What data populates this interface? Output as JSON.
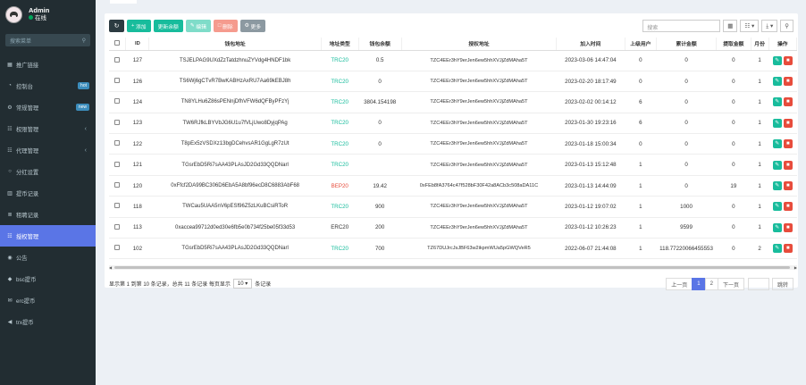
{
  "user": {
    "name": "Admin",
    "status": "在线"
  },
  "sidebar": {
    "search_placeholder": "搜索菜单",
    "items": [
      {
        "label": "推广链接",
        "icon": "table-icon"
      },
      {
        "label": "控制台",
        "icon": "dashboard-icon",
        "badge": "hot",
        "badge_color": "#3c8dbc"
      },
      {
        "label": "常规管理",
        "icon": "cogs-icon",
        "badge": "new",
        "badge_color": "#3c8dbc"
      },
      {
        "label": "权限管理",
        "icon": "group-icon",
        "arrow": true
      },
      {
        "label": "代理管理",
        "icon": "users-icon",
        "arrow": true
      },
      {
        "label": "分红设置",
        "icon": "circle-icon"
      },
      {
        "label": "提币记录",
        "icon": "chart-icon"
      },
      {
        "label": "租聘记录",
        "icon": "list-icon"
      },
      {
        "label": "授权管理",
        "icon": "users-icon",
        "active": true
      },
      {
        "label": "公告",
        "icon": "dot-circle-icon"
      },
      {
        "label": "bsc提币",
        "icon": "car-icon"
      },
      {
        "label": "erc提币",
        "icon": "envelope-icon"
      },
      {
        "label": "trx提币",
        "icon": "backward-icon"
      }
    ]
  },
  "toolbar": {
    "add": "添加",
    "update_balance": "更新余额",
    "edit": "编辑",
    "delete": "删除",
    "more": "更多",
    "search_placeholder": "搜索"
  },
  "table": {
    "headers": [
      "ID",
      "钱包地址",
      "地址类型",
      "钱包余额",
      "授权地址",
      "加入时间",
      "上级用户",
      "累计金额",
      "提取金额",
      "月份",
      "操作"
    ],
    "rows": [
      {
        "id": "127",
        "addr": "TSJELPAG9UXdZzTatdzhnuZYVdg4HNDF1bk",
        "type": "TRC20",
        "balance": "0.5",
        "auth": "TZC4EEr3hY9erJen6ew5hhXVJjZdMAha5T",
        "time": "2023-03-06 14:47:04",
        "parent": "0",
        "total": "0",
        "withdraw": "0",
        "month": "1"
      },
      {
        "id": "126",
        "addr": "TS6Wj6gCTvR7BwKABHzAxRU7Aa69kEBJ8h",
        "type": "TRC20",
        "balance": "0",
        "auth": "TZC4EEr3hY9erJen6ew5hhXVJjZdMAha5T",
        "time": "2023-02-20 18:17:49",
        "parent": "0",
        "total": "0",
        "withdraw": "0",
        "month": "1"
      },
      {
        "id": "124",
        "addr": "TN8YLHu6Z86sPENnjDfhVFW6dQFByPFzYj",
        "type": "TRC20",
        "balance": "3804.154198",
        "auth": "TZC4EEr3hY9erJen6ew5hhXVJjZdMAha5T",
        "time": "2023-02-02 00:14:12",
        "parent": "6",
        "total": "0",
        "withdraw": "0",
        "month": "1"
      },
      {
        "id": "123",
        "addr": "TW6RJfkLBYVbJG6U1u7fVLjUwo8DyjqPAg",
        "type": "TRC20",
        "balance": "0",
        "auth": "TZC4EEr3hY9erJen6ew5hhXVJjZdMAha5T",
        "time": "2023-01-30 19:23:16",
        "parent": "6",
        "total": "0",
        "withdraw": "0",
        "month": "1"
      },
      {
        "id": "122",
        "addr": "T8pEx5zVSDXz13bgDCehvsAR1GgLgR7zUt",
        "type": "TRC20",
        "balance": "0",
        "auth": "TZC4EEr3hY9erJen6ew5hhXVJjZdMAha5T",
        "time": "2023-01-18 15:00:34",
        "parent": "0",
        "total": "0",
        "withdraw": "0",
        "month": "1"
      },
      {
        "id": "121",
        "addr": "TGsrEbD5Ri7sAA43PLAsJD2Gd33QQDNarl",
        "type": "TRC20",
        "balance": "",
        "auth": "TZC4EEr3hY9erJen6ew5hhXVJjZdMAha5T",
        "time": "2023-01-13 15:12:48",
        "parent": "1",
        "total": "0",
        "withdraw": "0",
        "month": "1"
      },
      {
        "id": "120",
        "addr": "0xFfcf2DA99BC306D6EbA5A8bf96ecD8C6883AbF68",
        "type": "BEP20",
        "balance": "19.42",
        "auth": "0xFEb8fA3764c47f528bF30F42a8ACb3c508aDA11C",
        "time": "2023-01-13 14:44:09",
        "parent": "1",
        "total": "0",
        "withdraw": "19",
        "month": "1"
      },
      {
        "id": "118",
        "addr": "TWCau5UAA5nV6pESf96Z5zLKuBCsiRToR",
        "type": "TRC20",
        "balance": "900",
        "auth": "TZC4EEr3hY9erJen6ew5hhXVJjZdMAha5T",
        "time": "2023-01-12 19:07:02",
        "parent": "1",
        "total": "1000",
        "withdraw": "0",
        "month": "1"
      },
      {
        "id": "113",
        "addr": "0xaccea99712d0ed30e6fb5e0b734f25be05f33d53",
        "type": "ERC20",
        "balance": "200",
        "auth": "TZC4EEr3hY9erJen6ew5hhXVJjZdMAha5T",
        "time": "2023-01-12 10:26:23",
        "parent": "1",
        "total": "9599",
        "withdraw": "0",
        "month": "1"
      },
      {
        "id": "102",
        "addr": "TGsrEbD5Ri7sAA43PLAsJD2Gd33QQDNarl",
        "type": "TRC20",
        "balance": "700",
        "auth": "TZ67DUJrcJsJBF63w2ikpmWUa5pGWQVeR5",
        "time": "2022-06-07 21:44:08",
        "parent": "1",
        "total": "118.77220066455553",
        "withdraw": "0",
        "month": "2"
      }
    ]
  },
  "footer": {
    "summary": "显示第 1 到第 10 条记录，总共 11 条记录 每页显示",
    "page_size": "10",
    "suffix": "条记录",
    "prev": "上一页",
    "pages": [
      "1",
      "2"
    ],
    "next": "下一页",
    "jump": "跳转"
  }
}
